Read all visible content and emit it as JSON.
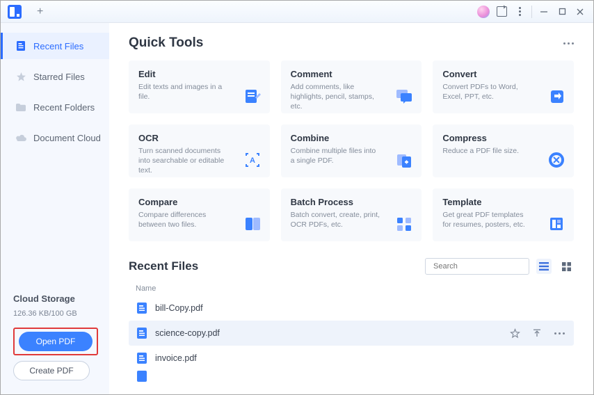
{
  "sidebar": {
    "items": [
      {
        "label": "Recent Files",
        "icon": "file-icon"
      },
      {
        "label": "Starred Files",
        "icon": "star-icon"
      },
      {
        "label": "Recent Folders",
        "icon": "folder-icon"
      },
      {
        "label": "Document Cloud",
        "icon": "cloud-icon"
      }
    ],
    "cloud_title": "Cloud Storage",
    "cloud_usage": "126.36 KB/100 GB",
    "open_label": "Open PDF",
    "create_label": "Create PDF"
  },
  "quick_tools": {
    "title": "Quick Tools",
    "tools": [
      {
        "title": "Edit",
        "desc": "Edit texts and images in a file."
      },
      {
        "title": "Comment",
        "desc": "Add comments, like highlights, pencil, stamps, etc."
      },
      {
        "title": "Convert",
        "desc": "Convert PDFs to Word, Excel, PPT, etc."
      },
      {
        "title": "OCR",
        "desc": "Turn scanned documents into searchable or editable text."
      },
      {
        "title": "Combine",
        "desc": "Combine multiple files into a single PDF."
      },
      {
        "title": "Compress",
        "desc": "Reduce a PDF file size."
      },
      {
        "title": "Compare",
        "desc": "Compare differences between two files."
      },
      {
        "title": "Batch Process",
        "desc": "Batch convert, create, print, OCR PDFs, etc."
      },
      {
        "title": "Template",
        "desc": "Get great PDF templates for resumes, posters, etc."
      }
    ]
  },
  "recent_files": {
    "title": "Recent Files",
    "search_placeholder": "Search",
    "col_name": "Name",
    "rows": [
      {
        "name": "bill-Copy.pdf"
      },
      {
        "name": "science-copy.pdf",
        "hover": true
      },
      {
        "name": "invoice.pdf"
      }
    ]
  }
}
